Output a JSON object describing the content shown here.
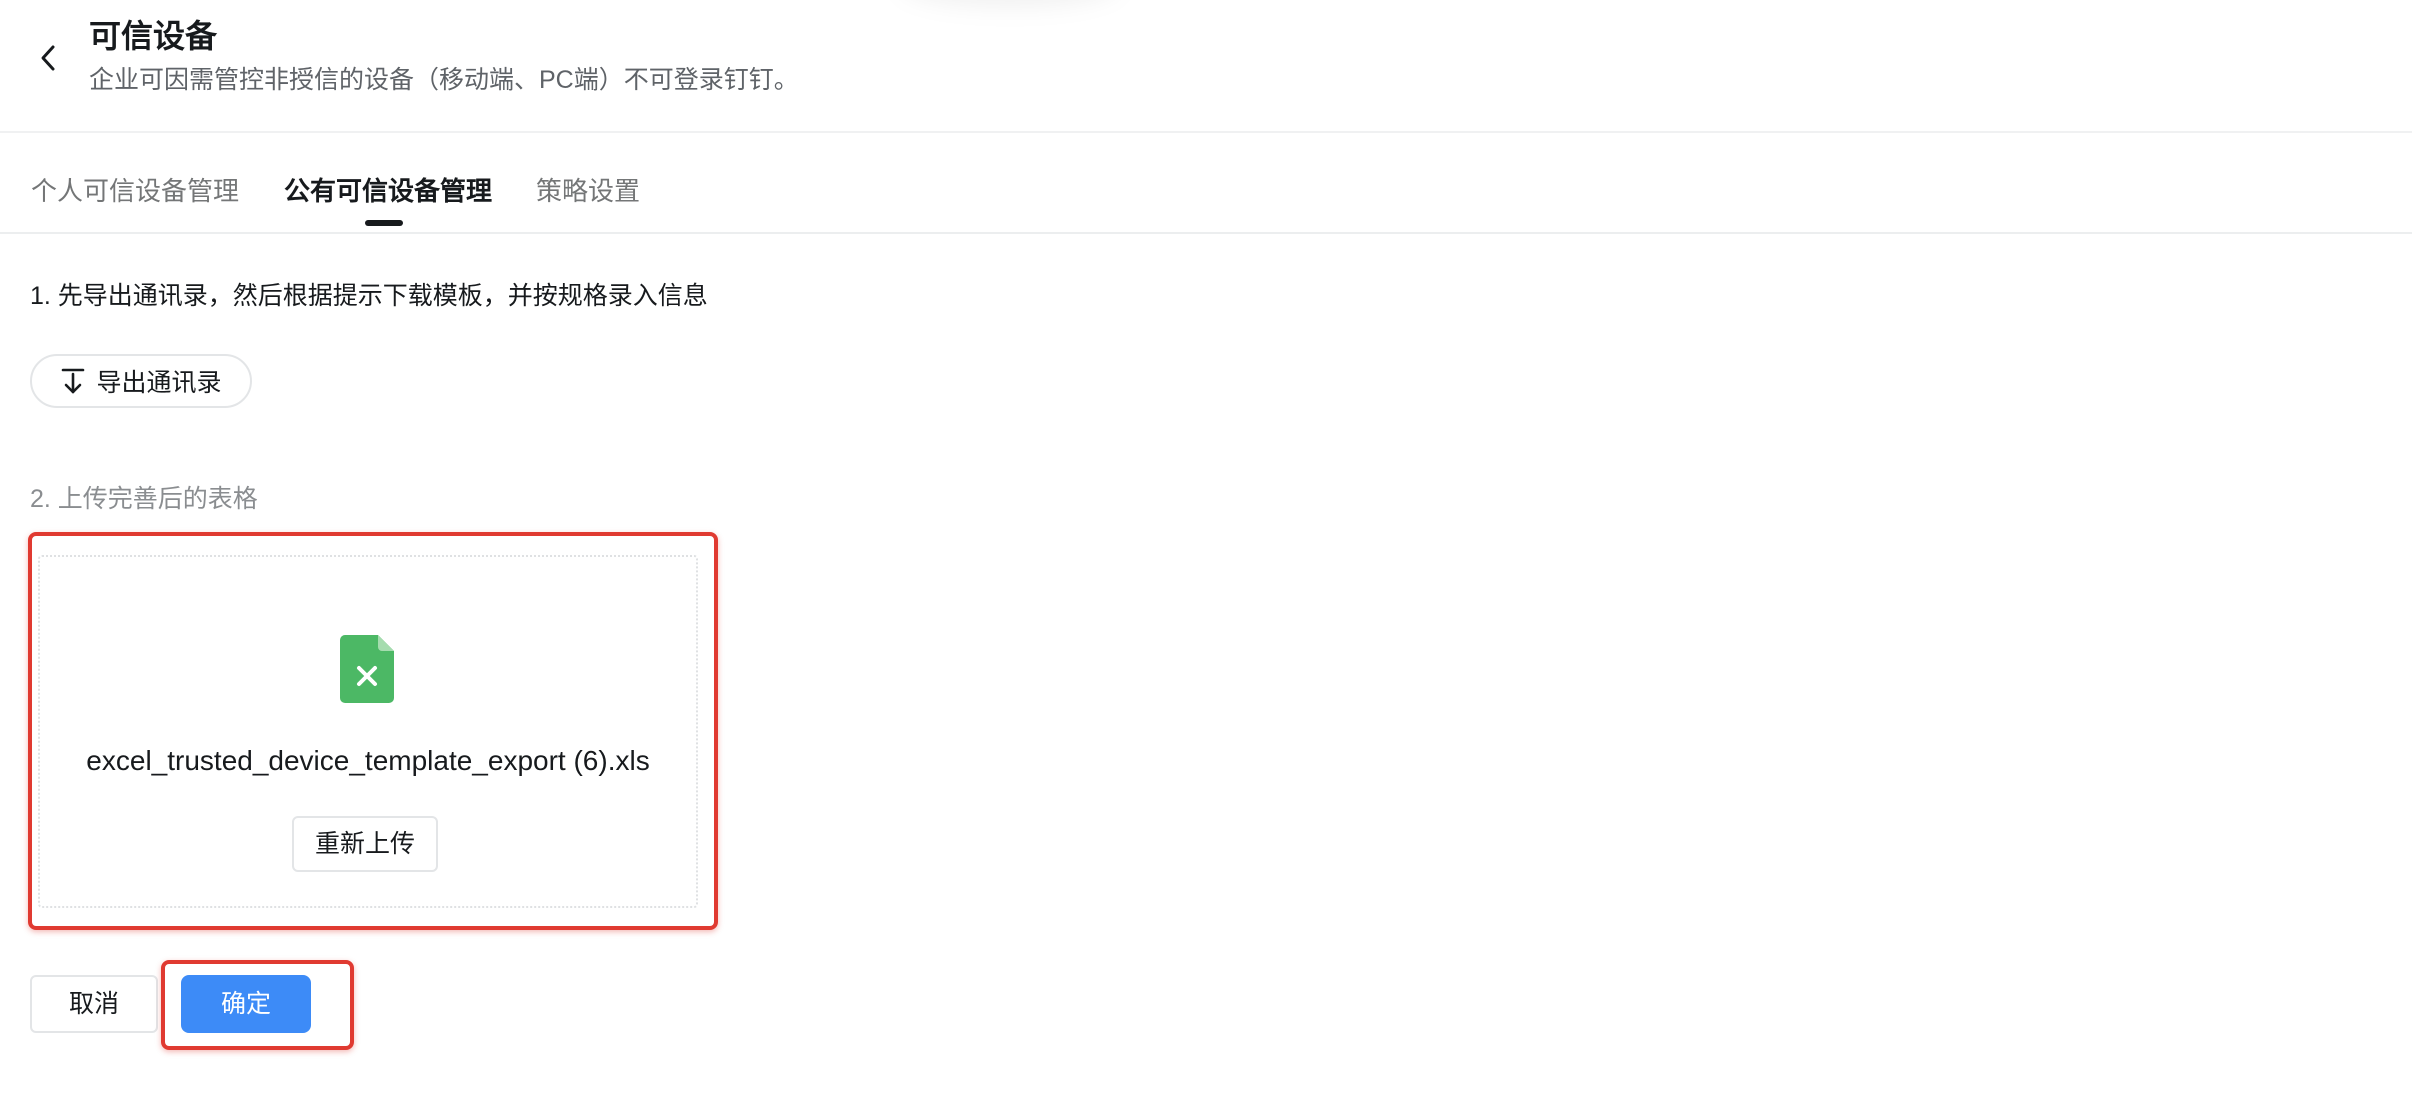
{
  "header": {
    "title": "可信设备",
    "description": "企业可因需管控非授信的设备（移动端、PC端）不可登录钉钉。"
  },
  "tabs": [
    {
      "label": "个人可信设备管理",
      "active": false
    },
    {
      "label": "公有可信设备管理",
      "active": true
    },
    {
      "label": "策略设置",
      "active": false
    }
  ],
  "steps": {
    "step1": "1. 先导出通讯录，然后根据提示下载模板，并按规格录入信息",
    "export_label": "导出通讯录",
    "step2": "2. 上传完善后的表格"
  },
  "upload": {
    "file_name": "excel_trusted_device_template_export (6).xls",
    "reupload_label": "重新上传",
    "file_icon": "excel-file-icon",
    "icon_color": "#4cb865"
  },
  "actions": {
    "cancel_label": "取消",
    "confirm_label": "确定",
    "confirm_color": "#3d8bf7"
  },
  "highlight_color": "#e03a31"
}
